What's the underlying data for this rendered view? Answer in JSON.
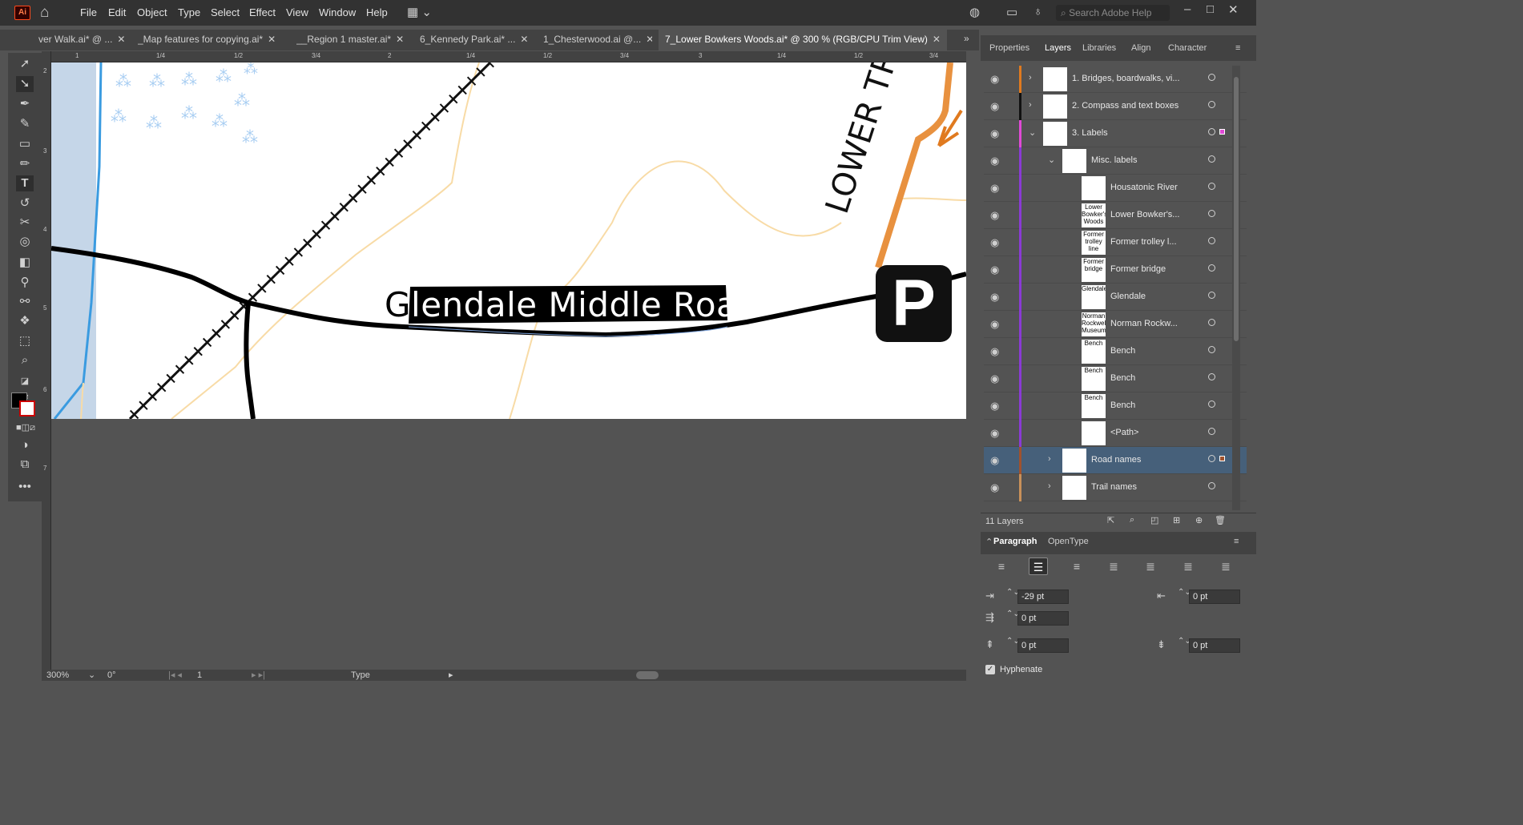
{
  "app": {
    "logo": "Ai"
  },
  "menu": [
    "File",
    "Edit",
    "Object",
    "Type",
    "Select",
    "Effect",
    "View",
    "Window",
    "Help"
  ],
  "search": {
    "placeholder": "Search Adobe Help"
  },
  "tabs": [
    {
      "label": "ver Walk.ai* @ ...",
      "active": false
    },
    {
      "label": "_Map features for copying.ai*",
      "active": false
    },
    {
      "label": "__Region 1 master.ai*",
      "active": false
    },
    {
      "label": "6_Kennedy Park.ai* ...",
      "active": false
    },
    {
      "label": "1_Chesterwood.ai @...",
      "active": false
    },
    {
      "label": "7_Lower Bowkers Woods.ai* @ 300 % (RGB/CPU Trim View)",
      "active": true
    }
  ],
  "ruler_top_ticks": [
    "1",
    "1/4",
    "1/2",
    "3/4",
    "2",
    "1/4",
    "1/2",
    "3/4",
    "3",
    "1/4",
    "1/2",
    "3/4"
  ],
  "ruler_left_ticks": [
    "2",
    "3",
    "4",
    "5",
    "6",
    "7"
  ],
  "canvas": {
    "selected_text": "Glendale Middle Road",
    "trail_text": "LOWER TR",
    "parking_symbol": "P"
  },
  "status": {
    "zoom": "300%",
    "rotation": "0°",
    "artboard": "1",
    "tool": "Type"
  },
  "panel_tabs": [
    {
      "label": "Properties",
      "active": false
    },
    {
      "label": "Layers",
      "active": true
    },
    {
      "label": "Libraries",
      "active": false
    },
    {
      "label": "Align",
      "active": false
    },
    {
      "label": "Character",
      "active": false
    }
  ],
  "layers": [
    {
      "name": "1. Bridges, boardwalks, vi...",
      "thumb": "",
      "color": "#e07a1f",
      "indent": 0,
      "expandable": true,
      "expanded": false,
      "selected": false
    },
    {
      "name": "2. Compass and text boxes",
      "thumb": "",
      "color": "#111111",
      "indent": 0,
      "expandable": true,
      "expanded": false,
      "selected": false
    },
    {
      "name": "3. Labels",
      "thumb": "",
      "color": "#e04ad6",
      "indent": 0,
      "expandable": true,
      "expanded": true,
      "selected": false
    },
    {
      "name": "Misc. labels",
      "thumb": "",
      "color": "#8a3ad6",
      "indent": 1,
      "expandable": true,
      "expanded": true,
      "selected": false
    },
    {
      "name": "Housatonic River",
      "thumb": "",
      "color": "#8a3ad6",
      "indent": 2,
      "expandable": false,
      "expanded": false,
      "selected": false
    },
    {
      "name": "Lower Bowker's...",
      "thumb": "Lower Bowker's Woods",
      "color": "#8a3ad6",
      "indent": 2,
      "expandable": false,
      "expanded": false,
      "selected": false
    },
    {
      "name": "Former trolley l...",
      "thumb": "Former trolley line",
      "color": "#8a3ad6",
      "indent": 2,
      "expandable": false,
      "expanded": false,
      "selected": false
    },
    {
      "name": "Former bridge",
      "thumb": "Former bridge",
      "color": "#8a3ad6",
      "indent": 2,
      "expandable": false,
      "expanded": false,
      "selected": false
    },
    {
      "name": "Glendale",
      "thumb": "Glendale",
      "color": "#8a3ad6",
      "indent": 2,
      "expandable": false,
      "expanded": false,
      "selected": false
    },
    {
      "name": "Norman Rockw...",
      "thumb": "Norman Rockwell Museum",
      "color": "#8a3ad6",
      "indent": 2,
      "expandable": false,
      "expanded": false,
      "selected": false
    },
    {
      "name": "Bench",
      "thumb": "Bench",
      "color": "#8a3ad6",
      "indent": 2,
      "expandable": false,
      "expanded": false,
      "selected": false
    },
    {
      "name": "Bench",
      "thumb": "Bench",
      "color": "#8a3ad6",
      "indent": 2,
      "expandable": false,
      "expanded": false,
      "selected": false
    },
    {
      "name": "Bench",
      "thumb": "Bench",
      "color": "#8a3ad6",
      "indent": 2,
      "expandable": false,
      "expanded": false,
      "selected": false
    },
    {
      "name": "<Path>",
      "thumb": "",
      "color": "#8a3ad6",
      "indent": 2,
      "expandable": false,
      "expanded": false,
      "selected": false
    },
    {
      "name": "Road names",
      "thumb": "",
      "color": "#a0522d",
      "indent": 1,
      "expandable": true,
      "expanded": false,
      "selected": true
    },
    {
      "name": "Trail names",
      "thumb": "",
      "color": "#c9915a",
      "indent": 1,
      "expandable": true,
      "expanded": false,
      "selected": false
    }
  ],
  "layer_count": "11 Layers",
  "paragraph": {
    "tabs": [
      {
        "label": "Paragraph",
        "active": true
      },
      {
        "label": "OpenType",
        "active": false
      }
    ],
    "left_indent": "-29 pt",
    "right_indent": "0 pt",
    "first_line_indent": "0 pt",
    "space_before": "0 pt",
    "space_after": "0 pt",
    "hyphenate_label": "Hyphenate",
    "hyphenate_checked": true
  }
}
